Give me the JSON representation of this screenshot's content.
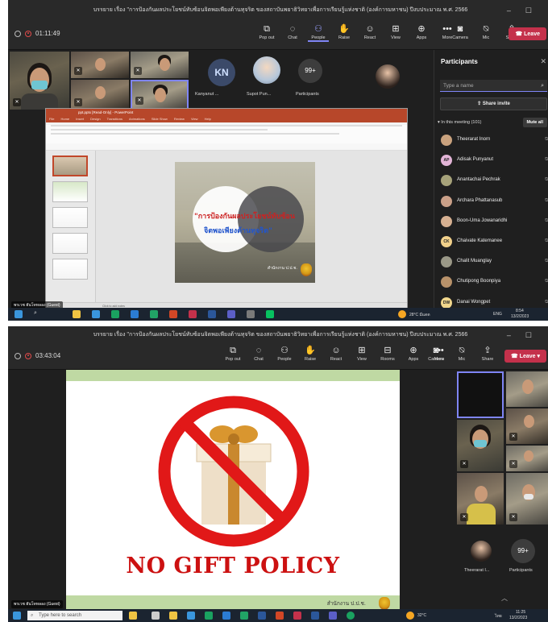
{
  "shot1": {
    "title": "บรรยาย เรื่อง \"การป้องกันผลประโยชน์ทับซ้อนจิตพอเพียงต้านทุจริต ของสถาบันพยาธิวิทยาเพื่อการเรียนรู้แห่งชาติ (องค์การมหาชน) ปีงบประมาณ พ.ศ. 2566",
    "timer": "01:11:49",
    "toolbar": [
      {
        "label": "Pop out",
        "icon": "pop-out-icon",
        "glyph": "⧉"
      },
      {
        "label": "Chat",
        "icon": "chat-icon",
        "glyph": "◌"
      },
      {
        "label": "People",
        "icon": "people-icon",
        "glyph": "⚇",
        "active": true
      },
      {
        "label": "Raise",
        "icon": "raise-hand-icon",
        "glyph": "✋"
      },
      {
        "label": "React",
        "icon": "react-icon",
        "glyph": "☺"
      },
      {
        "label": "View",
        "icon": "view-icon",
        "glyph": "⊞"
      },
      {
        "label": "Apps",
        "icon": "apps-icon",
        "glyph": "⊕"
      },
      {
        "label": "More",
        "icon": "more-icon",
        "glyph": "•••"
      }
    ],
    "devices": [
      {
        "label": "Camera",
        "icon": "camera-off-icon",
        "glyph": "◙"
      },
      {
        "label": "Mic",
        "icon": "mic-off-icon",
        "glyph": "⍉"
      },
      {
        "label": "Share",
        "icon": "share-icon",
        "glyph": "⇪"
      }
    ],
    "leave_label": "Leave",
    "tiles": {
      "kanyanut": "Kanyanut ...",
      "kanyanut_initials": "KN",
      "supot": "Supot Pun...",
      "participants_count": "99+",
      "participants_label": "Participants"
    },
    "ppt": {
      "title": "ppt.pptx [Read-Only] - PowerPoint",
      "tabs": [
        "File",
        "Home",
        "Insert",
        "Design",
        "Transitions",
        "Animations",
        "Slide Show",
        "Review",
        "View",
        "Help"
      ],
      "slide_title_line1": "\"การป้องกันผลประโยชน์ทับซ้อน",
      "slide_title_line2": "จิตพอเพียงต้านทุจริต\"",
      "slide_footer": "สำนักงาน ป.ป.ช.",
      "notes": "Click to add notes"
    },
    "presenter_tag": "พรเวช ฮันโทหลอง (Guest)",
    "panel": {
      "title": "Participants",
      "search_placeholder": "Type a name",
      "share_invite": "Share invite",
      "meeting_header": "In this meeting (101)",
      "mute_all": "Mute all",
      "participants": [
        {
          "name": "Theerarat Inorn",
          "initials": "",
          "color": "#c9a27e"
        },
        {
          "name": "Adisak Punyanut",
          "initials": "AP",
          "color": "#e2b4d6"
        },
        {
          "name": "Anantachai Pechrak",
          "initials": "",
          "color": "#a6a27a"
        },
        {
          "name": "Archara Phattanasub",
          "initials": "",
          "color": "#caa088"
        },
        {
          "name": "Boon-Uma Jowanaridhi",
          "initials": "",
          "color": "#d6b091"
        },
        {
          "name": "Chaivate Katemanee",
          "initials": "CK",
          "color": "#f1d08a"
        },
        {
          "name": "Chalit Muanglay",
          "initials": "",
          "color": "#9a9887"
        },
        {
          "name": "Chutipong Boonpiya",
          "initials": "",
          "color": "#b8926a"
        },
        {
          "name": "Danai Wongpet",
          "initials": "DW",
          "color": "#f0d68c"
        }
      ]
    },
    "taskbar": {
      "weather": "28°C  มีแดด",
      "lang": "ENG",
      "time": "8:54",
      "date": "13/2/2023"
    }
  },
  "shot2": {
    "title": "บรรยาย เรื่อง \"การป้องกันผลประโยชน์ทับซ้อนจิตพอเพียงต้านทุจริต ของสถาบันพยาธิวิทยาเพื่อการเรียนรู้แห่งชาติ (องค์การมหาชน) ปีงบประมาณ พ.ศ. 2566",
    "timer": "03:43:04",
    "toolbar": [
      {
        "label": "Pop out",
        "icon": "pop-out-icon",
        "glyph": "⧉"
      },
      {
        "label": "Chat",
        "icon": "chat-icon",
        "glyph": "◌"
      },
      {
        "label": "People",
        "icon": "people-icon",
        "glyph": "⚇"
      },
      {
        "label": "Raise",
        "icon": "raise-hand-icon",
        "glyph": "✋"
      },
      {
        "label": "React",
        "icon": "react-icon",
        "glyph": "☺"
      },
      {
        "label": "View",
        "icon": "view-icon",
        "glyph": "⊞"
      },
      {
        "label": "Rooms",
        "icon": "rooms-icon",
        "glyph": "⊟"
      },
      {
        "label": "Apps",
        "icon": "apps-icon",
        "glyph": "⊕"
      },
      {
        "label": "More",
        "icon": "more-icon",
        "glyph": "•••"
      }
    ],
    "devices": [
      {
        "label": "Camera",
        "icon": "camera-off-icon",
        "glyph": "◙"
      },
      {
        "label": "Mic",
        "icon": "mic-off-icon",
        "glyph": "⍉"
      },
      {
        "label": "Share",
        "icon": "share-icon",
        "glyph": "⇪"
      }
    ],
    "leave_label": "Leave",
    "slide_text": "NO GIFT POLICY",
    "slide_footer": "สำนักงาน ป.ป.ช.",
    "presenter_tag": "พรเวช ฮันโทหลอง (Guest)",
    "side": {
      "theerarat": "Theerarat I...",
      "participants_count": "99+",
      "participants_label": "Participants"
    },
    "taskbar": {
      "search_placeholder": "Type here to search",
      "weather": "32°C",
      "lang": "ไทย",
      "time": "11:25",
      "date": "13/2/2023"
    }
  },
  "colors": {
    "teams_bg": "#1f1f1f",
    "teams_accent": "#7f85f5",
    "leave": "#c4314b",
    "ppt_red": "#b7472a",
    "slide_red": "#cc1111",
    "band_green": "#bfd9a3"
  }
}
